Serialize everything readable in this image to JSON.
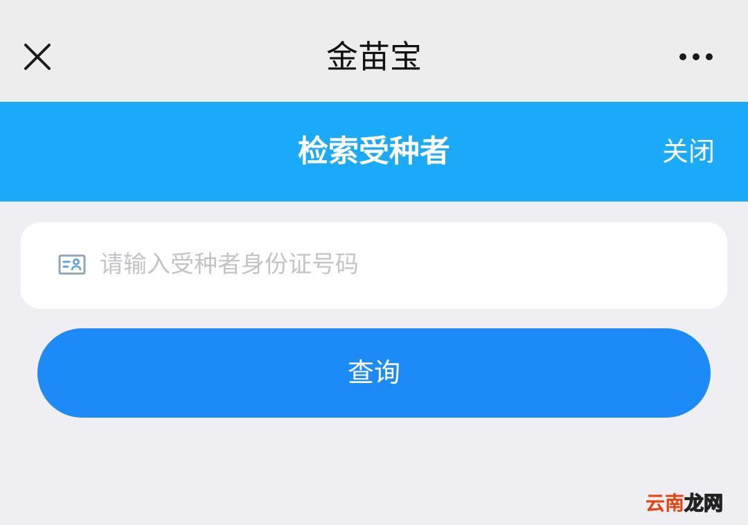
{
  "window": {
    "title": "金苗宝",
    "close_icon": "close-x-icon",
    "more_icon": "more-dots-icon"
  },
  "banner": {
    "title": "检索受种者",
    "close_label": "关闭",
    "background": "#1aaaf9"
  },
  "search": {
    "icon": "id-card-icon",
    "placeholder": "请输入受种者身份证号码",
    "value": ""
  },
  "actions": {
    "query_label": "查询",
    "query_color": "#1c8af7"
  },
  "watermark": {
    "part1": "云南",
    "part2": "龙网"
  }
}
